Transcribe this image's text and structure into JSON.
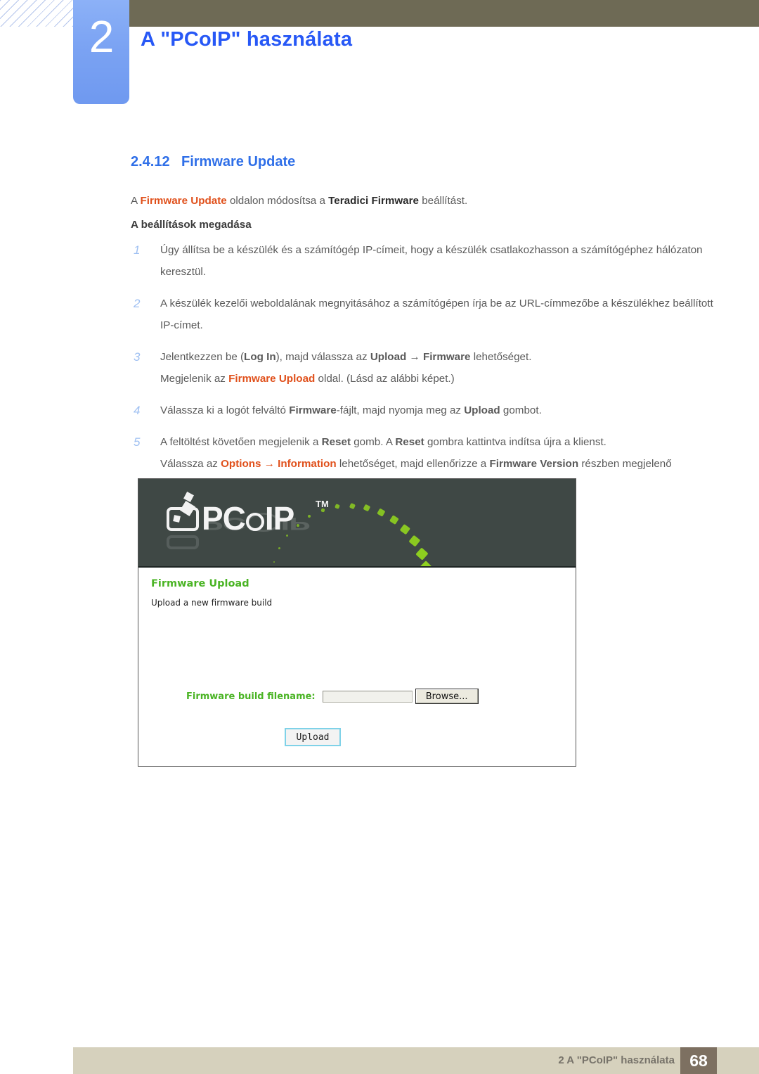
{
  "header": {
    "chapter_number": "2",
    "chapter_title": "A \"PCoIP\" használata"
  },
  "section": {
    "number": "2.4.12",
    "title": "Firmware Update"
  },
  "intro": {
    "p1_a": "A ",
    "p1_highlight": "Firmware Update",
    "p1_b": " oldalon módosítsa a ",
    "p1_bold": "Teradici Firmware",
    "p1_c": " beállítást."
  },
  "lead": "A beállítások megadása",
  "steps": [
    {
      "marker": "1",
      "parts": [
        {
          "t": "Úgy állítsa be a készülék és a számítógép IP-címeit, hogy a készülék csatlakozhasson a számítógéphez hálózaton keresztül.",
          "s": "plain"
        }
      ]
    },
    {
      "marker": "2",
      "parts": [
        {
          "t": "A készülék kezelői weboldalának megnyitásához a számítógépen írja be az URL-címmezőbe a készülékhez beállított IP-címet.",
          "s": "plain"
        }
      ]
    },
    {
      "marker": "3",
      "parts": [
        {
          "t": "Jelentkezzen be (",
          "s": "plain"
        },
        {
          "t": "Log In",
          "s": "bold"
        },
        {
          "t": "), majd válassza az ",
          "s": "plain"
        },
        {
          "t": "Upload",
          "s": "bold"
        },
        {
          "t": " → ",
          "s": "plain"
        },
        {
          "t": "Firmware",
          "s": "bold"
        },
        {
          "t": " lehetőséget.",
          "s": "plain"
        },
        {
          "t": "\n",
          "s": "break"
        },
        {
          "t": "Megjelenik az ",
          "s": "plain"
        },
        {
          "t": "Firmware Upload",
          "s": "orange"
        },
        {
          "t": " oldal. (Lásd az alábbi képet.)",
          "s": "plain"
        }
      ]
    },
    {
      "marker": "4",
      "parts": [
        {
          "t": "Válassza ki a logót felváltó ",
          "s": "plain"
        },
        {
          "t": "Firmware",
          "s": "bold"
        },
        {
          "t": "-fájlt, majd nyomja meg az ",
          "s": "plain"
        },
        {
          "t": "Upload",
          "s": "bold"
        },
        {
          "t": " gombot.",
          "s": "plain"
        }
      ]
    },
    {
      "marker": "5",
      "parts": [
        {
          "t": "A feltöltést követően megjelenik a ",
          "s": "plain"
        },
        {
          "t": "Reset",
          "s": "bold"
        },
        {
          "t": " gomb. A ",
          "s": "plain"
        },
        {
          "t": "Reset",
          "s": "bold"
        },
        {
          "t": " gombra kattintva indítsa újra a klienst.",
          "s": "plain"
        },
        {
          "t": "\n",
          "s": "break"
        },
        {
          "t": "Válassza az ",
          "s": "plain"
        },
        {
          "t": "Options",
          "s": "orange"
        },
        {
          "t": " → ",
          "s": "orange"
        },
        {
          "t": "Information",
          "s": "orange"
        },
        {
          "t": " lehetőséget, majd ellenőrizze a ",
          "s": "plain"
        },
        {
          "t": "Firmware Version",
          "s": "bold"
        },
        {
          "t": " részben megjelenő információkat.",
          "s": "plain"
        }
      ]
    }
  ],
  "screenshot": {
    "logo_text_1": "PC",
    "logo_text_2": "IP",
    "logo_tm": "TM",
    "panel_title": "Firmware Upload",
    "panel_subtitle": "Upload a new firmware build",
    "field_label": "Firmware build filename:",
    "field_value": "",
    "browse_label": "Browse...",
    "upload_label": "Upload"
  },
  "footer": {
    "breadcrumb": "2 A \"PCoIP\" használata",
    "page": "68"
  },
  "colors": {
    "chapter_title": "#2758f6",
    "section_heading": "#2f6fe8",
    "highlight_orange": "#e0501b",
    "olive_bar": "#6e6a55",
    "tab_blue": "#7ba3f3",
    "footer_bar": "#d6d1bd",
    "page_box": "#7d7061",
    "screenshot_green": "#4ab424",
    "banner_dark": "#3f4845",
    "particle_green": "#8fd11f"
  }
}
